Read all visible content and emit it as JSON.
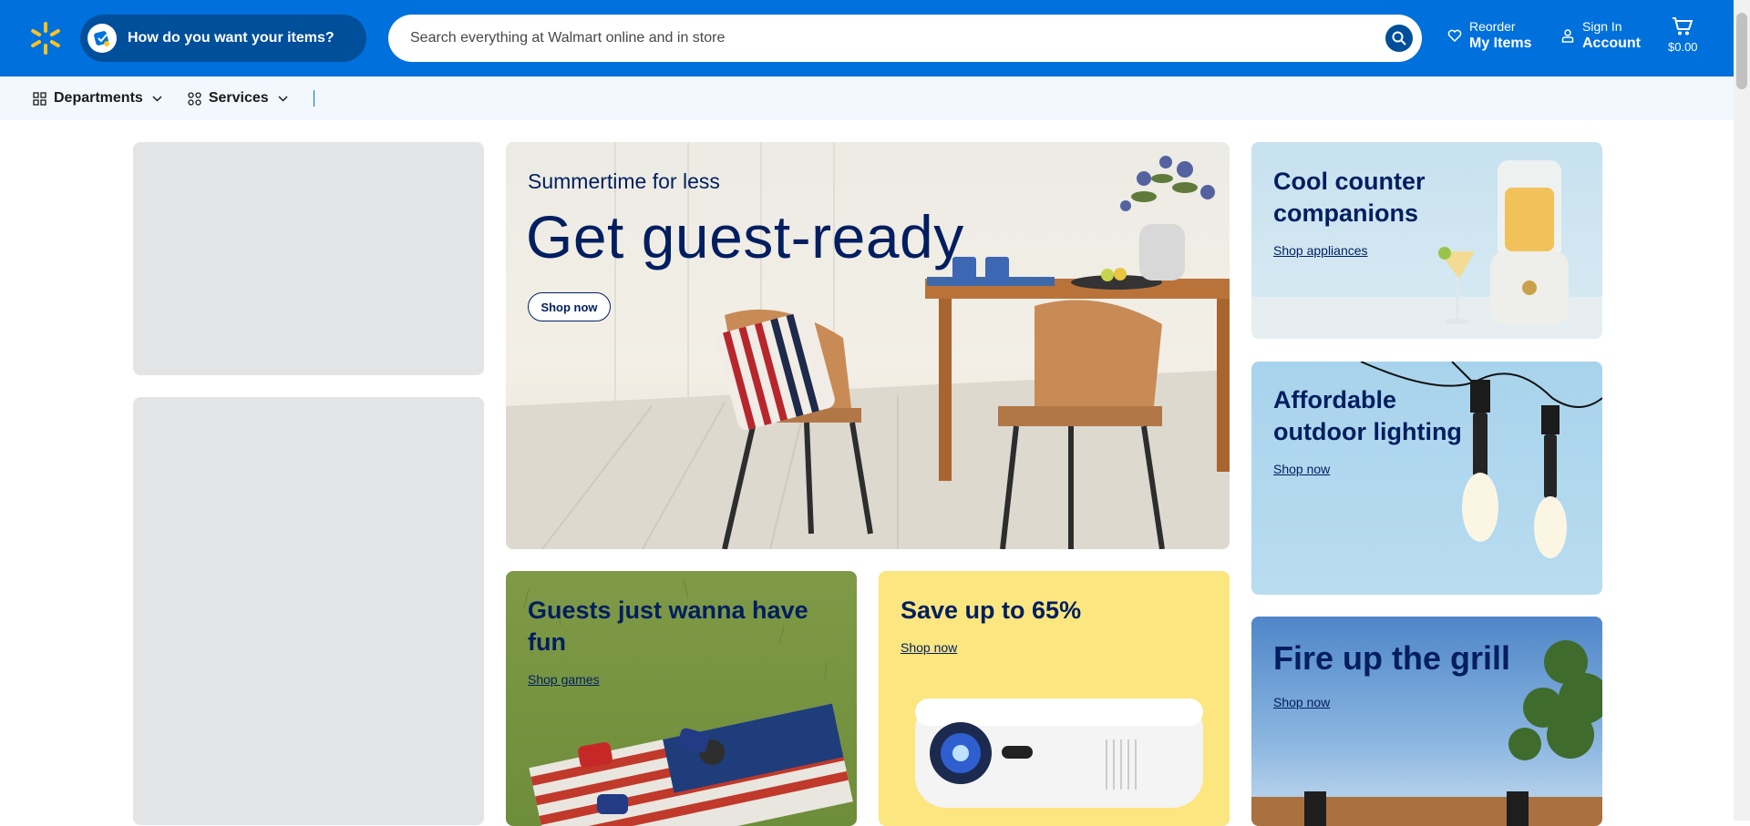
{
  "header": {
    "delivery_label": "How do you want your items?",
    "search_placeholder": "Search everything at Walmart online and in store",
    "reorder_small": "Reorder",
    "reorder_big": "My Items",
    "signin_small": "Sign In",
    "signin_big": "Account",
    "cart_amount": "$0.00",
    "colors": {
      "brand_blue": "#0071dc",
      "dark_blue": "#004f9a",
      "spark_yellow": "#ffc220"
    }
  },
  "subnav": {
    "departments": "Departments",
    "services": "Services"
  },
  "hero": {
    "subtitle": "Summertime for less",
    "title": "Get guest-ready",
    "button": "Shop now"
  },
  "tiles": {
    "counter": {
      "title_line1": "Cool counter",
      "title_line2": "companions",
      "link": "Shop appliances"
    },
    "lighting": {
      "title_line1": "Affordable",
      "title_line2": "outdoor lighting",
      "link": "Shop now"
    },
    "games": {
      "title_line1": "Guests just wanna have",
      "title_line2": "fun",
      "link": "Shop games"
    },
    "save": {
      "title": "Save up to 65%",
      "link": "Shop now"
    },
    "grill": {
      "title": "Fire up the grill",
      "link": "Shop now"
    }
  },
  "icons": [
    "spark-logo-icon",
    "delivery-icon",
    "search-icon",
    "heart-icon",
    "user-icon",
    "cart-icon",
    "grid-icon",
    "services-icon",
    "chevron-down-icon"
  ]
}
